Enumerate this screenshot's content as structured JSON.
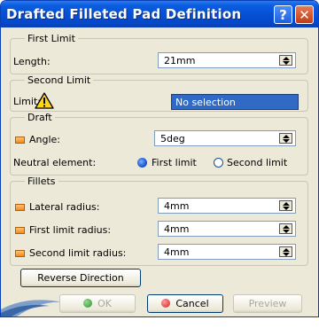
{
  "window": {
    "title": "Drafted Filleted Pad Definition"
  },
  "titlebar_buttons": {
    "help": "?",
    "close": "✕"
  },
  "first_limit": {
    "legend": "First Limit",
    "length_label": "Length:",
    "length_value": "21mm"
  },
  "second_limit": {
    "legend": "Second Limit",
    "limit_label": "Limit:",
    "limit_value": "No selection"
  },
  "draft": {
    "legend": "Draft",
    "angle_label": "Angle:",
    "angle_value": "5deg",
    "neutral_label": "Neutral element:",
    "neutral_options": [
      "First limit",
      "Second limit"
    ],
    "neutral_selected": "First limit"
  },
  "fillets": {
    "legend": "Fillets",
    "lateral_label": "Lateral radius:",
    "lateral_value": "4mm",
    "first_label": "First limit radius:",
    "first_value": "4mm",
    "second_label": "Second limit radius:",
    "second_value": "4mm"
  },
  "actions": {
    "reverse": "Reverse Direction",
    "ok": "OK",
    "cancel": "Cancel",
    "preview": "Preview"
  },
  "colors": {
    "title_bar": "#0650d6",
    "selection": "#316ac5",
    "ok_icon": "#2e8b2e",
    "cancel_icon": "#d02020"
  }
}
